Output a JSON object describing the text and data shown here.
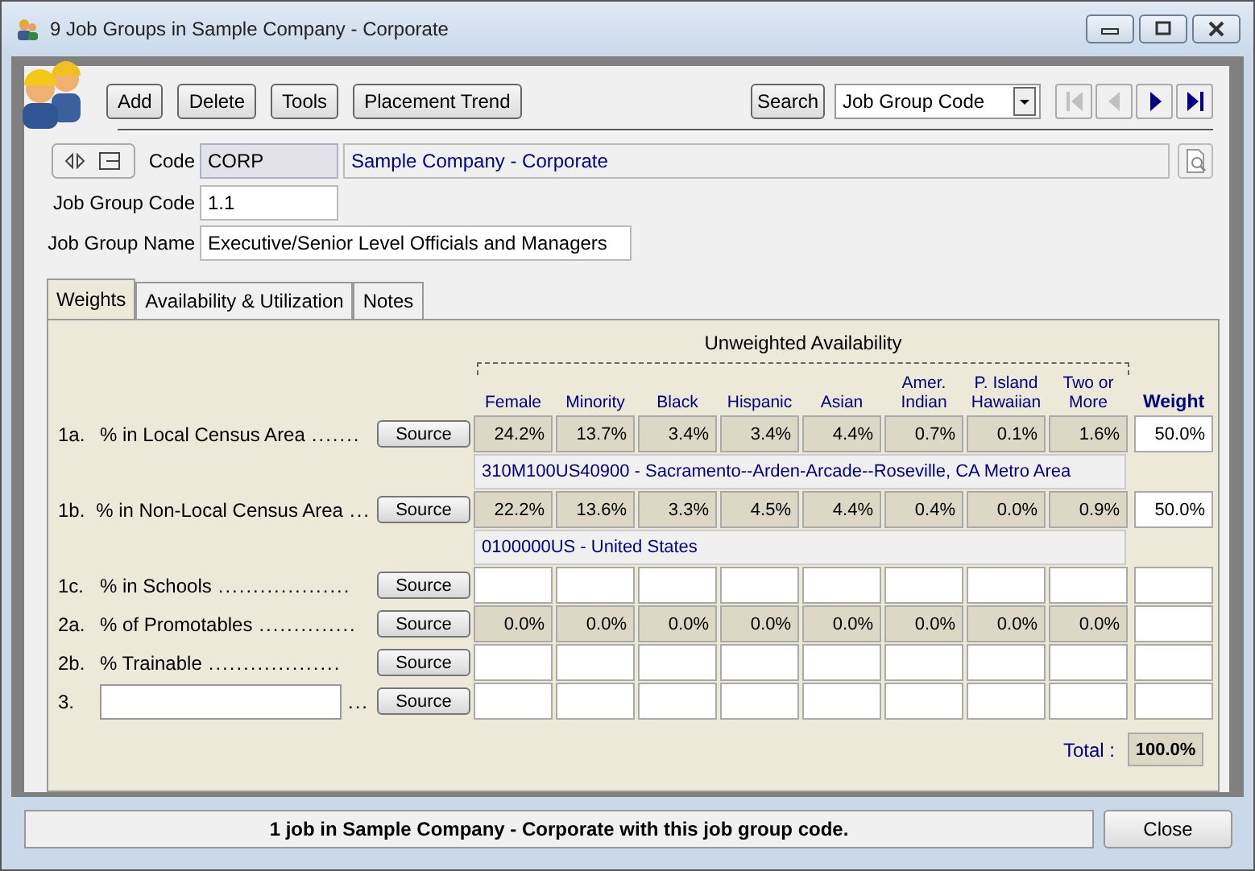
{
  "window": {
    "title": "9 Job Groups in Sample Company - Corporate"
  },
  "toolbar": {
    "buttons": [
      "Add",
      "Delete",
      "Tools",
      "Placement Trend"
    ],
    "search_button": "Search",
    "search_field": {
      "value": "Job Group Code"
    }
  },
  "nav": [
    {
      "kind": "first",
      "disabled": true
    },
    {
      "kind": "prev",
      "disabled": true
    },
    {
      "kind": "next",
      "disabled": false
    },
    {
      "kind": "last",
      "disabled": false
    }
  ],
  "form": {
    "firm_code_label": "Code",
    "firm_code": "CORP",
    "firm_name": "Sample Company - Corporate",
    "job_group_code_label": "Job Group Code",
    "job_group_code": "1.1",
    "job_group_name_label": "Job Group Name",
    "job_group_name": "Executive/Senior Level Officials and Managers"
  },
  "tabs": [
    {
      "label": "Weights",
      "selected": true
    },
    {
      "label": "Availability & Utilization",
      "selected": false
    },
    {
      "label": "Notes",
      "selected": false
    }
  ],
  "grid": {
    "group_title": "Unweighted Availability",
    "columns": [
      "Female",
      "Minority",
      "Black",
      "Hispanic",
      "Asian",
      "Amer.\nIndian",
      "P. Island\nHawaiian",
      "Two or\nMore"
    ],
    "weight_column": "Weight",
    "rows": [
      {
        "kind": "measure",
        "code": "1a.",
        "label": "% in Local Census Area",
        "leader": ".......",
        "source_button": "Source",
        "values": [
          "24.2%",
          "13.7%",
          "3.4%",
          "3.4%",
          "4.4%",
          "0.7%",
          "0.1%",
          "1.6%"
        ],
        "weight": "50.0%",
        "area": "310M100US40900 - Sacramento--Arden-Arcade--Roseville, CA Metro Area"
      },
      {
        "kind": "measure",
        "code": "1b.",
        "label": "% in Non-Local Census Area",
        "leader": "...",
        "source_button": "Source",
        "values": [
          "22.2%",
          "13.6%",
          "3.3%",
          "4.5%",
          "4.4%",
          "0.4%",
          "0.0%",
          "0.9%"
        ],
        "weight": "50.0%",
        "area": "0100000US - United States"
      },
      {
        "kind": "measure",
        "code": "1c.",
        "label": "% in Schools",
        "leader": "...................",
        "source_button": "Source",
        "values": []
      },
      {
        "kind": "measure",
        "code": "2a.",
        "label": "% of Promotables",
        "leader": "..............",
        "source_button": "Source",
        "values": [
          "0.0%",
          "0.0%",
          "0.0%",
          "0.0%",
          "0.0%",
          "0.0%",
          "0.0%",
          "0.0%"
        ]
      },
      {
        "kind": "measure",
        "code": "2b.",
        "label": "% Trainable",
        "leader": "...................",
        "source_button": "Source",
        "values": []
      },
      {
        "kind": "custom",
        "code": "3.",
        "leader": "...",
        "source_button": "Source",
        "values": []
      }
    ],
    "total_label": "Total :",
    "total": "100.0%"
  },
  "status_bar": {
    "message": "1 job in Sample Company - Corporate with this job group code.",
    "close_button": "Close"
  }
}
